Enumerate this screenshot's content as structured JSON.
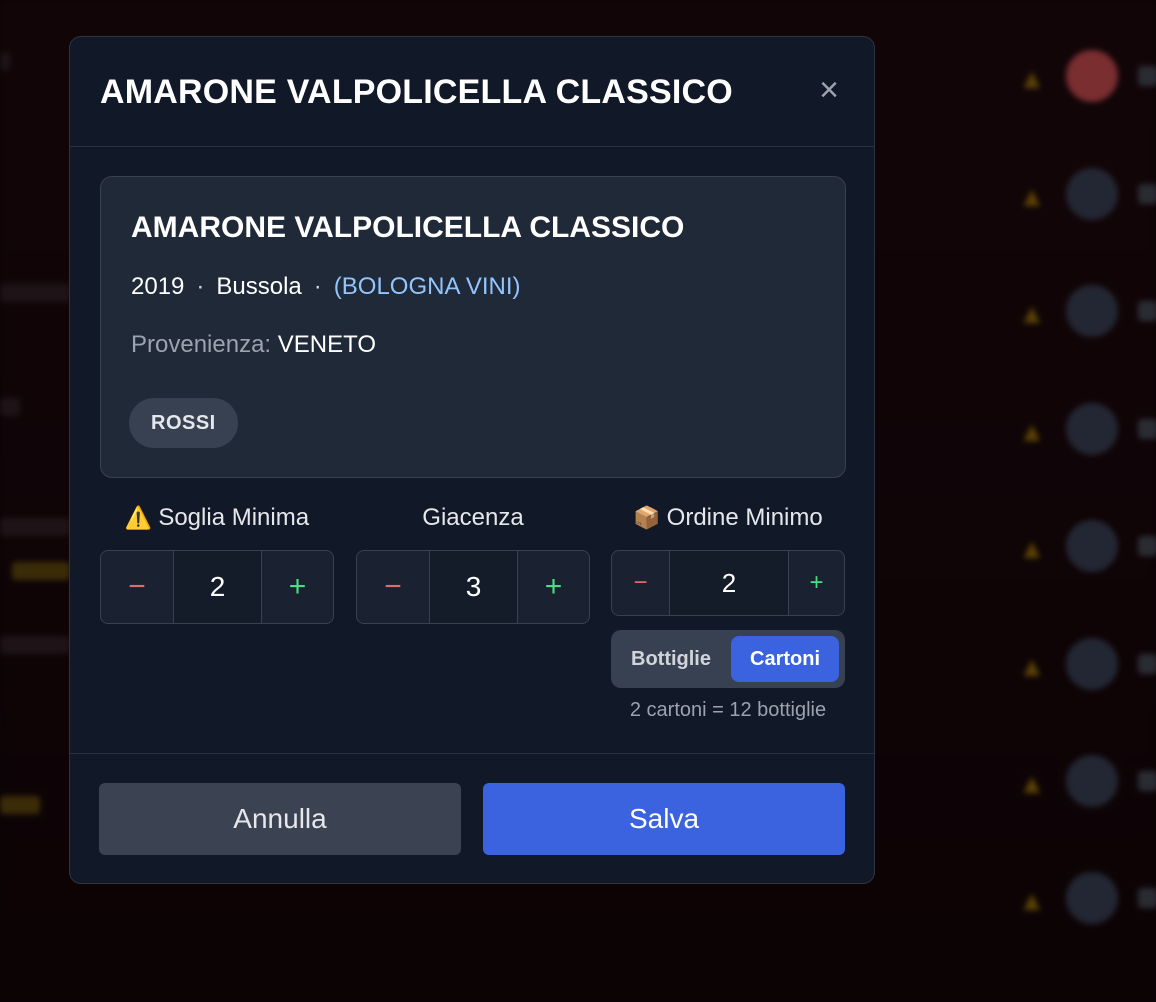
{
  "modal": {
    "title": "AMARONE VALPOLICELLA CLASSICO",
    "close_icon": "close-icon"
  },
  "wine": {
    "name": "AMARONE VALPOLICELLA CLASSICO",
    "year": "2019",
    "producer": "Bussola",
    "supplier": "(BOLOGNA VINI)",
    "separator": "·",
    "origin_label": "Provenienza:",
    "origin_value": "VENETO",
    "category_tag": "ROSSI"
  },
  "fields": {
    "soglia": {
      "icon": "⚠️",
      "label": "Soglia Minima",
      "value": "2",
      "minus": "−",
      "plus": "+"
    },
    "giacenza": {
      "label": "Giacenza",
      "value": "3",
      "minus": "−",
      "plus": "+"
    },
    "ordine": {
      "icon": "📦",
      "label": "Ordine Minimo",
      "value": "2",
      "minus": "−",
      "plus": "+"
    }
  },
  "unit_toggle": {
    "options": [
      "Bottiglie",
      "Cartoni"
    ],
    "selected": "Cartoni",
    "note": "2 cartoni = 12 bottiglie"
  },
  "footer": {
    "cancel_label": "Annulla",
    "save_label": "Salva"
  },
  "colors": {
    "accent": "#3b63e0",
    "supplier_link": "#93c5fd",
    "minus": "#e06c6c",
    "plus": "#4ade80"
  }
}
